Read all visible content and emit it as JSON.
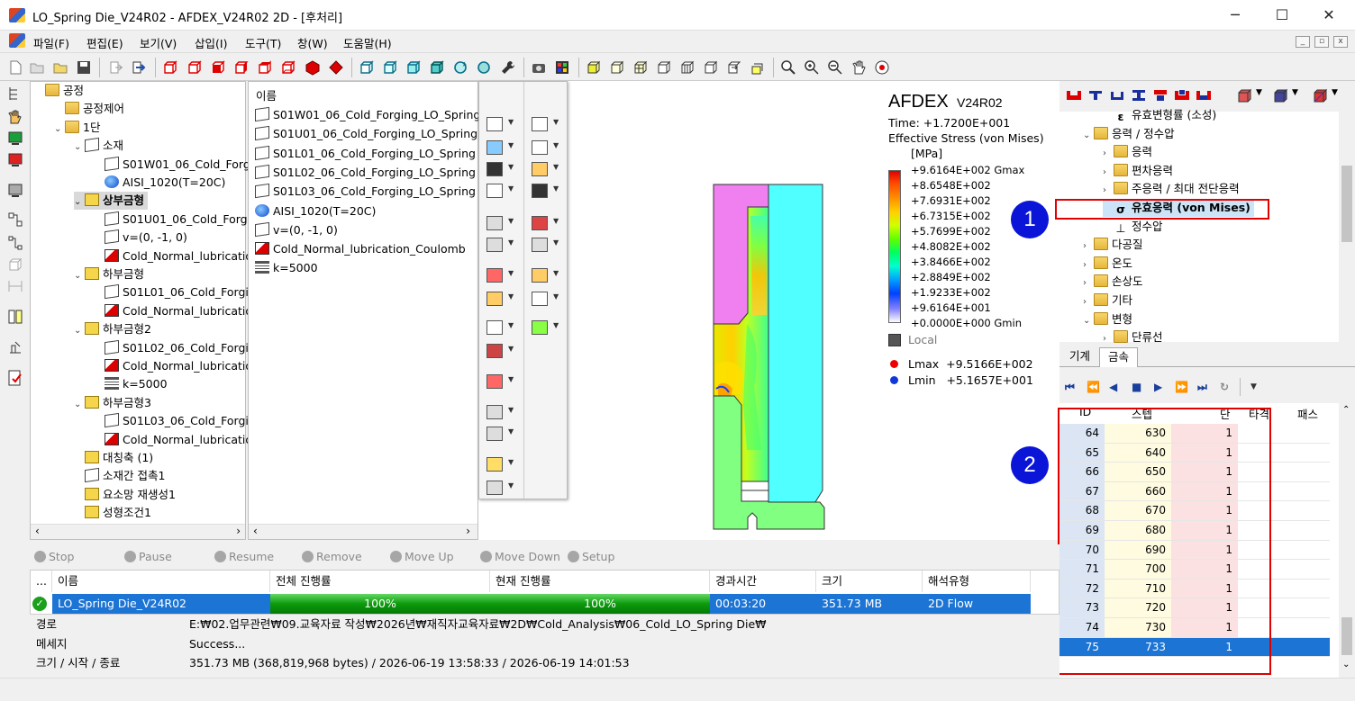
{
  "window": {
    "title": "LO_Spring Die_V24R02 - AFDEX_V24R02 2D - [후처리]",
    "minimize": "─",
    "maximize": "☐",
    "close": "✕"
  },
  "menu": [
    "파일(F)",
    "편집(E)",
    "보기(V)",
    "삽입(I)",
    "도구(T)",
    "창(W)",
    "도움말(H)"
  ],
  "process_tree": [
    {
      "label": "공정",
      "icon": "folder-icon",
      "exp": "",
      "indent": 0
    },
    {
      "label": "공정제어",
      "icon": "folder-icon",
      "exp": "",
      "indent": 1
    },
    {
      "label": "1단",
      "icon": "folder-icon",
      "exp": "⌄",
      "indent": 1
    },
    {
      "label": "소재",
      "icon": "billet-icon",
      "exp": "⌄",
      "indent": 2
    },
    {
      "label": "S01W01_06_Cold_Forgi",
      "icon": "part-icon",
      "exp": "",
      "indent": 3
    },
    {
      "label": "AISI_1020(T=20C)",
      "icon": "material-icon",
      "exp": "",
      "indent": 3
    },
    {
      "label": "상부금형",
      "icon": "die-icon",
      "exp": "⌄",
      "indent": 2,
      "selected": true
    },
    {
      "label": "S01U01_06_Cold_Forgir",
      "icon": "part-icon",
      "exp": "",
      "indent": 3
    },
    {
      "label": "v=(0, -1, 0)",
      "icon": "velocity-icon",
      "exp": "",
      "indent": 3
    },
    {
      "label": "Cold_Normal_lubricatior",
      "icon": "friction-icon",
      "exp": "",
      "indent": 3
    },
    {
      "label": "하부금형",
      "icon": "die-icon",
      "exp": "⌄",
      "indent": 2
    },
    {
      "label": "S01L01_06_Cold_Forgin",
      "icon": "part-icon",
      "exp": "",
      "indent": 3
    },
    {
      "label": "Cold_Normal_lubricatior",
      "icon": "friction-icon",
      "exp": "",
      "indent": 3
    },
    {
      "label": "하부금형2",
      "icon": "die-icon",
      "exp": "⌄",
      "indent": 2
    },
    {
      "label": "S01L02_06_Cold_Forgin",
      "icon": "part-icon",
      "exp": "",
      "indent": 3
    },
    {
      "label": "Cold_Normal_lubricatior",
      "icon": "friction-icon",
      "exp": "",
      "indent": 3
    },
    {
      "label": "k=5000",
      "icon": "spring-icon",
      "exp": "",
      "indent": 3
    },
    {
      "label": "하부금형3",
      "icon": "die-icon",
      "exp": "⌄",
      "indent": 2
    },
    {
      "label": "S01L03_06_Cold_Forgin",
      "icon": "part-icon",
      "exp": "",
      "indent": 3
    },
    {
      "label": "Cold_Normal_lubricatior",
      "icon": "friction-icon",
      "exp": "",
      "indent": 3
    },
    {
      "label": "대칭축 (1)",
      "icon": "symmetry-icon",
      "exp": "",
      "indent": 2
    },
    {
      "label": "소재간 접촉1",
      "icon": "contact-icon",
      "exp": "",
      "indent": 2
    },
    {
      "label": "요소망 재생성1",
      "icon": "remesh-icon",
      "exp": "",
      "indent": 2
    },
    {
      "label": "성형조건1",
      "icon": "condition-icon",
      "exp": "",
      "indent": 2
    }
  ],
  "name_list": {
    "header": "이름",
    "items": [
      {
        "label": "S01W01_06_Cold_Forging_LO_Spring",
        "icon": "part-icon"
      },
      {
        "label": "S01U01_06_Cold_Forging_LO_Spring",
        "icon": "part-icon"
      },
      {
        "label": "S01L01_06_Cold_Forging_LO_Spring .",
        "icon": "part-icon"
      },
      {
        "label": "S01L02_06_Cold_Forging_LO_Spring .",
        "icon": "part-icon"
      },
      {
        "label": "S01L03_06_Cold_Forging_LO_Spring .",
        "icon": "part-icon"
      },
      {
        "label": "AISI_1020(T=20C)",
        "icon": "material-icon"
      },
      {
        "label": "v=(0, -1, 0)",
        "icon": "velocity-icon"
      },
      {
        "label": "Cold_Normal_lubrication_Coulomb",
        "icon": "friction-icon"
      },
      {
        "label": "k=5000",
        "icon": "spring-icon"
      }
    ]
  },
  "legend": {
    "brand": "AFDEX",
    "version": "V24R02",
    "time": "Time: +1.7200E+001",
    "variable": "Effective Stress (von Mises)",
    "unit": "[MPa]",
    "levels": [
      "+9.6164E+002 Gmax",
      "+8.6548E+002",
      "+7.6931E+002",
      "+6.7315E+002",
      "+5.7699E+002",
      "+4.8082E+002",
      "+3.8466E+002",
      "+2.8849E+002",
      "+1.9233E+002",
      "+9.6164E+001",
      "+0.0000E+000 Gmin"
    ],
    "coord": "Local",
    "lmax": "Lmax  +9.5166E+002",
    "lmin": "Lmin   +5.1657E+001"
  },
  "result_tree": [
    {
      "label": "유효변형률 (소성)",
      "icon": "epsilon-icon",
      "exp": "",
      "indent": 2
    },
    {
      "label": "응력 / 정수압",
      "icon": "folder-icon",
      "exp": "⌄",
      "indent": 1
    },
    {
      "label": "응력",
      "icon": "folder-icon",
      "exp": "›",
      "indent": 2
    },
    {
      "label": "편차응력",
      "icon": "folder-icon",
      "exp": "›",
      "indent": 2
    },
    {
      "label": "주응력 / 최대 전단응력",
      "icon": "folder-icon",
      "exp": "›",
      "indent": 2
    },
    {
      "label": "유효응력 (von Mises)",
      "icon": "sigma-icon",
      "exp": "",
      "indent": 2,
      "selected": true
    },
    {
      "label": "정수압",
      "icon": "pressure-icon",
      "exp": "",
      "indent": 2
    },
    {
      "label": "다공질",
      "icon": "folder-icon",
      "exp": "›",
      "indent": 1
    },
    {
      "label": "온도",
      "icon": "folder-icon",
      "exp": "›",
      "indent": 1
    },
    {
      "label": "손상도",
      "icon": "folder-icon",
      "exp": "›",
      "indent": 1
    },
    {
      "label": "기타",
      "icon": "folder-icon",
      "exp": "›",
      "indent": 1
    },
    {
      "label": "변형",
      "icon": "folder-icon",
      "exp": "⌄",
      "indent": 1
    },
    {
      "label": "단류선",
      "icon": "folder-icon",
      "exp": "›",
      "indent": 2
    }
  ],
  "result_tabs": [
    "기계",
    "금속"
  ],
  "step_grid": {
    "headers": [
      "ID",
      "스텝",
      "단",
      "타격",
      "패스"
    ],
    "rows": [
      {
        "id": "64",
        "step": "630",
        "stage": "1"
      },
      {
        "id": "65",
        "step": "640",
        "stage": "1"
      },
      {
        "id": "66",
        "step": "650",
        "stage": "1"
      },
      {
        "id": "67",
        "step": "660",
        "stage": "1"
      },
      {
        "id": "68",
        "step": "670",
        "stage": "1"
      },
      {
        "id": "69",
        "step": "680",
        "stage": "1"
      },
      {
        "id": "70",
        "step": "690",
        "stage": "1"
      },
      {
        "id": "71",
        "step": "700",
        "stage": "1"
      },
      {
        "id": "72",
        "step": "710",
        "stage": "1"
      },
      {
        "id": "73",
        "step": "720",
        "stage": "1"
      },
      {
        "id": "74",
        "step": "730",
        "stage": "1"
      },
      {
        "id": "75",
        "step": "733",
        "stage": "1",
        "selected": true
      }
    ]
  },
  "annotations": {
    "badge1": "1",
    "badge2": "2"
  },
  "job_toolbar": [
    "Stop",
    "Pause",
    "Resume",
    "Remove",
    "Move Up",
    "Move Down",
    "Setup"
  ],
  "job_table": {
    "headers": [
      "...",
      "이름",
      "전체 진행률",
      "현재 진행률",
      "경과시간",
      "크기",
      "해석유형"
    ],
    "row": {
      "name": "LO_Spring Die_V24R02",
      "total_progress": "100%",
      "current_progress": "100%",
      "total_progress_value": 1.0,
      "current_progress_value": 1.0,
      "elapsed": "00:03:20",
      "size": "351.73 MB",
      "type": "2D Flow"
    }
  },
  "job_info": [
    {
      "label": "경로",
      "value": "E:₩02.업무관련₩09.교육자료 작성₩2026년₩재직자교육자료₩2D₩Cold_Analysis₩06_Cold_LO_Spring Die₩"
    },
    {
      "label": "메세지",
      "value": "Success..."
    },
    {
      "label": "크기 / 시작 / 종료",
      "value": "351.73 MB (368,819,968 bytes) / 2026-06-19 13:58:33 / 2026-06-19 14:01:53"
    }
  ],
  "colors": {
    "accent": "#1c74d4",
    "annotation": "#e00000",
    "badge": "#0a15d8",
    "progress": "#0d9a0d"
  }
}
